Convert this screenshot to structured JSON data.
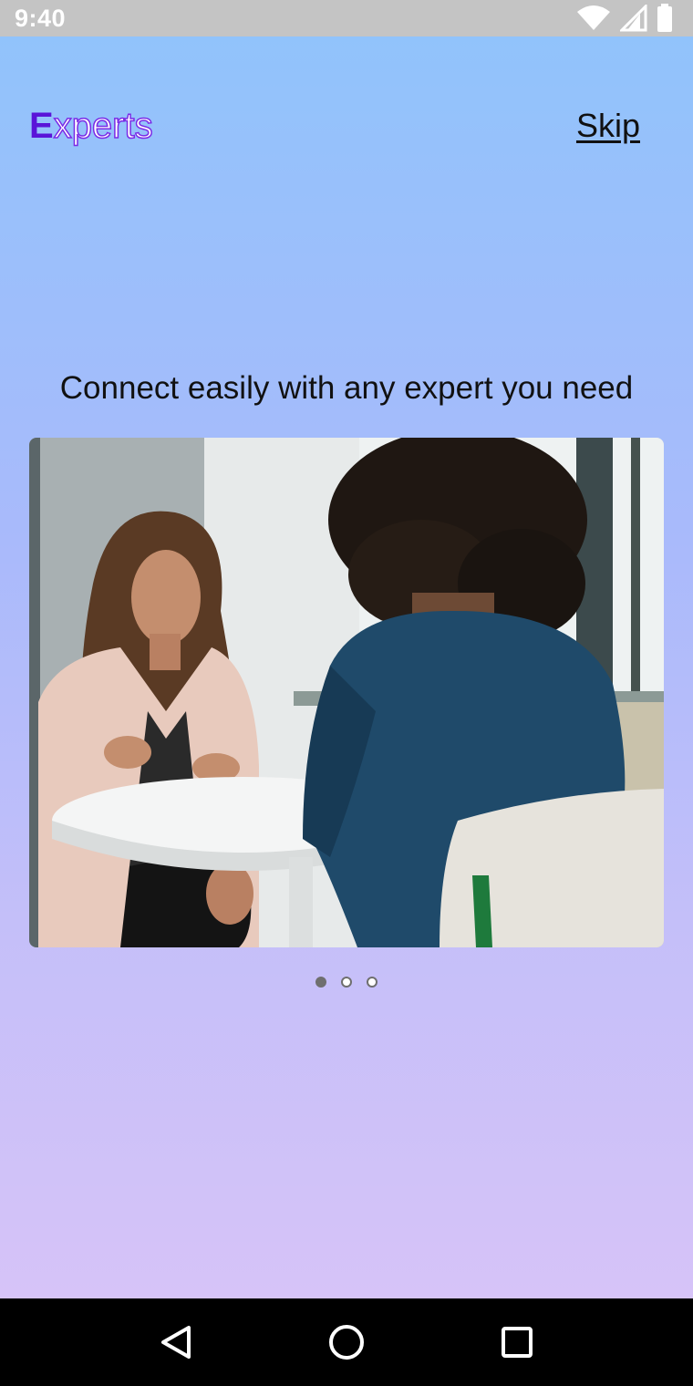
{
  "status_bar": {
    "time": "9:40",
    "icons": [
      "wifi-icon",
      "cellular-signal-icon",
      "battery-icon"
    ]
  },
  "header": {
    "logo_first_letter": "E",
    "logo_rest": "xperts",
    "skip_label": "Skip"
  },
  "onboarding": {
    "headline": "Connect easily with any expert you need",
    "image_subject": "two-women-talking-at-table",
    "pager": {
      "total": 3,
      "active_index": 0
    }
  },
  "nav_bar": {
    "buttons": [
      "back-icon",
      "home-icon",
      "recents-icon"
    ]
  },
  "colors": {
    "gradient_top": "#91c3fb",
    "gradient_bottom": "#d6c3f8",
    "logo_accent": "#5a14d8",
    "status_bar": "#c4c4c4",
    "nav_bar": "#000000"
  }
}
